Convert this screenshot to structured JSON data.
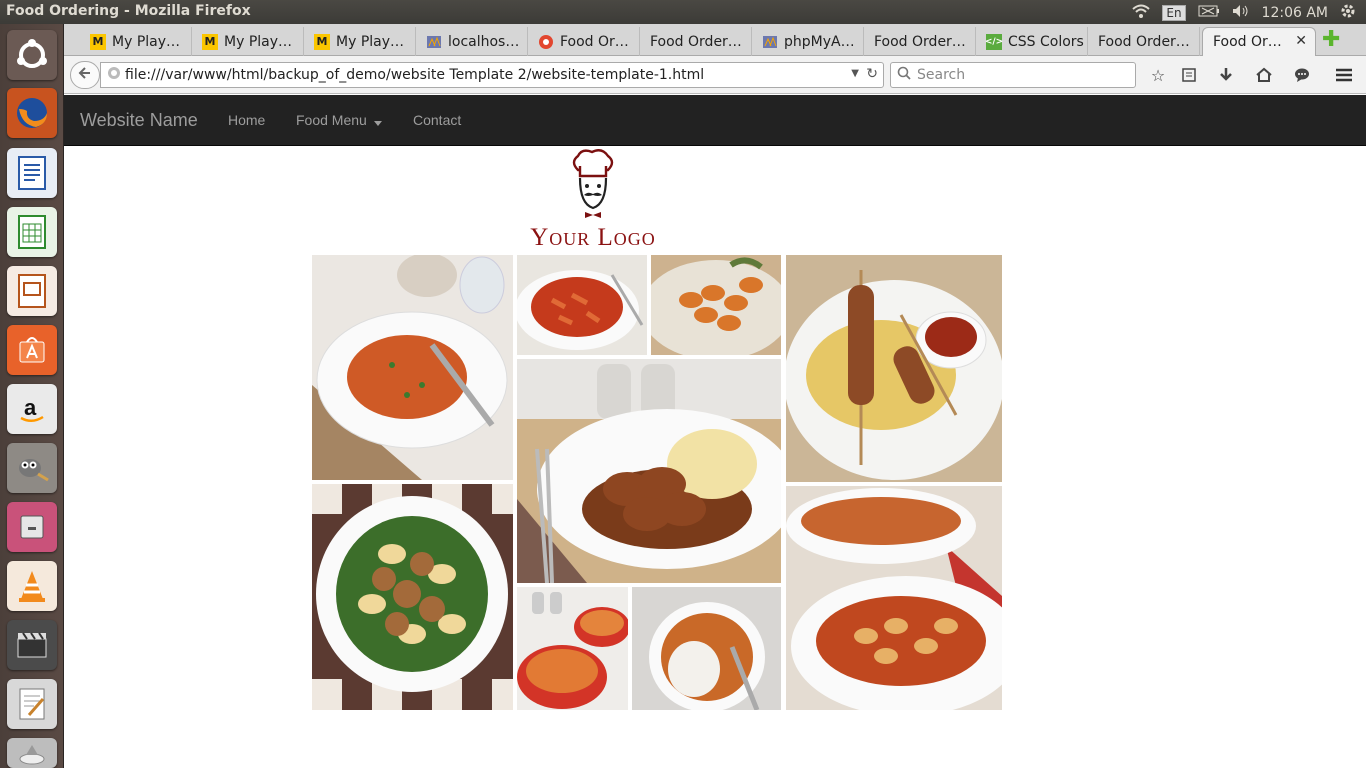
{
  "window": {
    "title": "Food Ordering - Mozilla Firefox",
    "language": "En",
    "time": "12:06 AM"
  },
  "tabs": [
    {
      "label": "My Play…",
      "icon": "M"
    },
    {
      "label": "My Play…",
      "icon": "M"
    },
    {
      "label": "My Play…",
      "icon": "M"
    },
    {
      "label": "localhos…",
      "icon": "pma"
    },
    {
      "label": "Food Or…",
      "icon": "food"
    },
    {
      "label": "Food Order…",
      "icon": ""
    },
    {
      "label": "phpMyA…",
      "icon": "pma"
    },
    {
      "label": "Food Order…",
      "icon": ""
    },
    {
      "label": "CSS Colors",
      "icon": "css"
    },
    {
      "label": "Food Order…",
      "icon": ""
    },
    {
      "label": "Food Or…",
      "icon": "",
      "active": true
    }
  ],
  "browser": {
    "url": "file:///var/www/html/backup_of_demo/website Template 2/website-template-1.html",
    "search_placeholder": "Search"
  },
  "site": {
    "brand": "Website Name",
    "nav": [
      "Home",
      "Food Menu",
      "Contact"
    ],
    "logo_text": "Your Logo",
    "logo_color": "#8b1212",
    "navbar_color": "#222222"
  },
  "gallery": [
    "lentil-soup",
    "penne-arrabbiata",
    "gnocchi-sage",
    "kebab-couscous",
    "sausage-mash",
    "meatball-pasta",
    "spaghetti-bowls",
    "curry-rice",
    "baked-gnocchi"
  ]
}
